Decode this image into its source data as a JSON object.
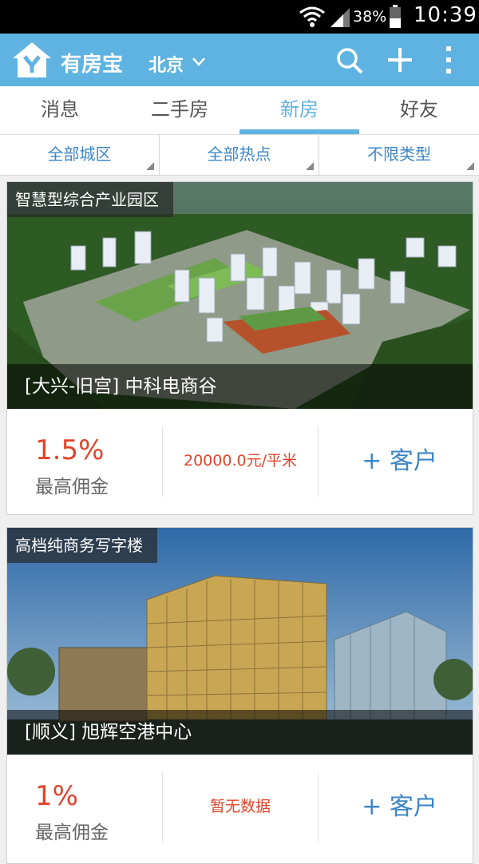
{
  "status_bar": {
    "battery_percent": "38%",
    "time": "10:39",
    "icons": [
      "wifi-icon",
      "signal-icon",
      "battery-icon"
    ]
  },
  "app_bar": {
    "title": "有房宝",
    "city": "北京",
    "icons": [
      "logo-icon",
      "chevron-down-icon",
      "search-icon",
      "plus-icon",
      "more-vertical-icon"
    ]
  },
  "tabs": [
    {
      "label": "消息",
      "active": false
    },
    {
      "label": "二手房",
      "active": false
    },
    {
      "label": "新房",
      "active": true
    },
    {
      "label": "好友",
      "active": false
    }
  ],
  "filters": [
    {
      "label": "全部城区"
    },
    {
      "label": "全部热点"
    },
    {
      "label": "不限类型"
    }
  ],
  "listings": [
    {
      "tag": "智慧型综合产业园区",
      "caption": "[大兴-旧宫] 中科电商谷",
      "commission": "1.5%",
      "commission_label": "最高佣金",
      "price": "20000.0元/平米",
      "add_client": "+ 客户"
    },
    {
      "tag": "高档纯商务写字楼",
      "caption": "[顺义] 旭辉空港中心",
      "commission": "1%",
      "commission_label": "最高佣金",
      "price": "暂无数据",
      "add_client": "+ 客户"
    }
  ],
  "colors": {
    "accent": "#5fb3e0",
    "filter_text": "#3c86c8",
    "highlight_red": "#e0442a"
  }
}
